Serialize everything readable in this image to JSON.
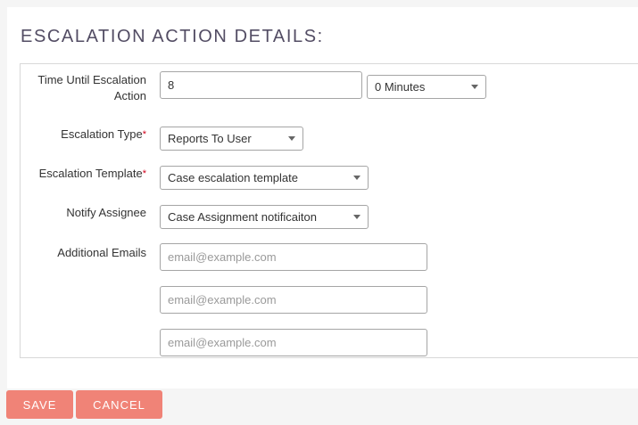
{
  "section": {
    "title": "ESCALATION ACTION DETAILS:"
  },
  "fields": {
    "time_until": {
      "label": "Time Until Escalation Action",
      "value": "8",
      "unit_selected": "0 Minutes"
    },
    "escalation_type": {
      "label": "Escalation Type",
      "required_marker": "*",
      "selected": "Reports To User"
    },
    "escalation_template": {
      "label": "Escalation Template",
      "required_marker": "*",
      "selected": "Case escalation template"
    },
    "notify_assignee": {
      "label": "Notify Assignee",
      "selected": "Case Assignment notificaiton"
    },
    "additional_emails": {
      "label": "Additional Emails",
      "placeholder": "email@example.com"
    }
  },
  "actions": {
    "save_label": "SAVE",
    "cancel_label": "CANCEL"
  },
  "colors": {
    "button_bg": "#f08377",
    "required": "#d0021b",
    "title": "#534d64"
  }
}
